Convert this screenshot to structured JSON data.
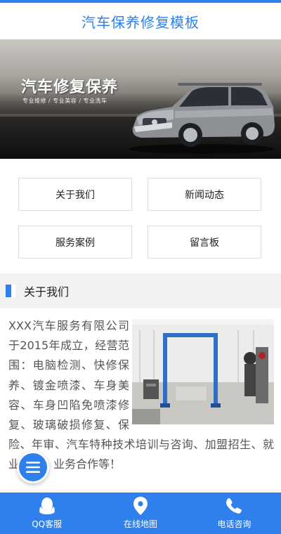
{
  "header": {
    "title": "汽车保养修复模板"
  },
  "banner": {
    "headline": "汽车修复保养",
    "tagline": "专业维修 / 专业美容 / 专业洗车",
    "slides": 2,
    "active_slide": 2
  },
  "nav": {
    "items": [
      {
        "label": "关于我们"
      },
      {
        "label": "新闻动态"
      },
      {
        "label": "服务案例"
      },
      {
        "label": "留言板"
      }
    ]
  },
  "section": {
    "title": "关于我们"
  },
  "about": {
    "text": "XXX汽车服务有限公司于2015年成立，经营范围：电脑检测、快修保养、镀金喷漆、车身美容、车身凹陷免喷漆修复、玻璃破损修复、保险、年审、汽车特种技术培训与咨询、加盟招生、就业培训、业务合作等！"
  },
  "bottom_bar": {
    "items": [
      {
        "label": "QQ客服",
        "icon": "qq-icon"
      },
      {
        "label": "在线地图",
        "icon": "map-pin-icon"
      },
      {
        "label": "电话咨询",
        "icon": "phone-icon"
      }
    ]
  },
  "colors": {
    "accent": "#2f80ed",
    "section_bg": "#f2f2f2",
    "text": "#555555"
  }
}
